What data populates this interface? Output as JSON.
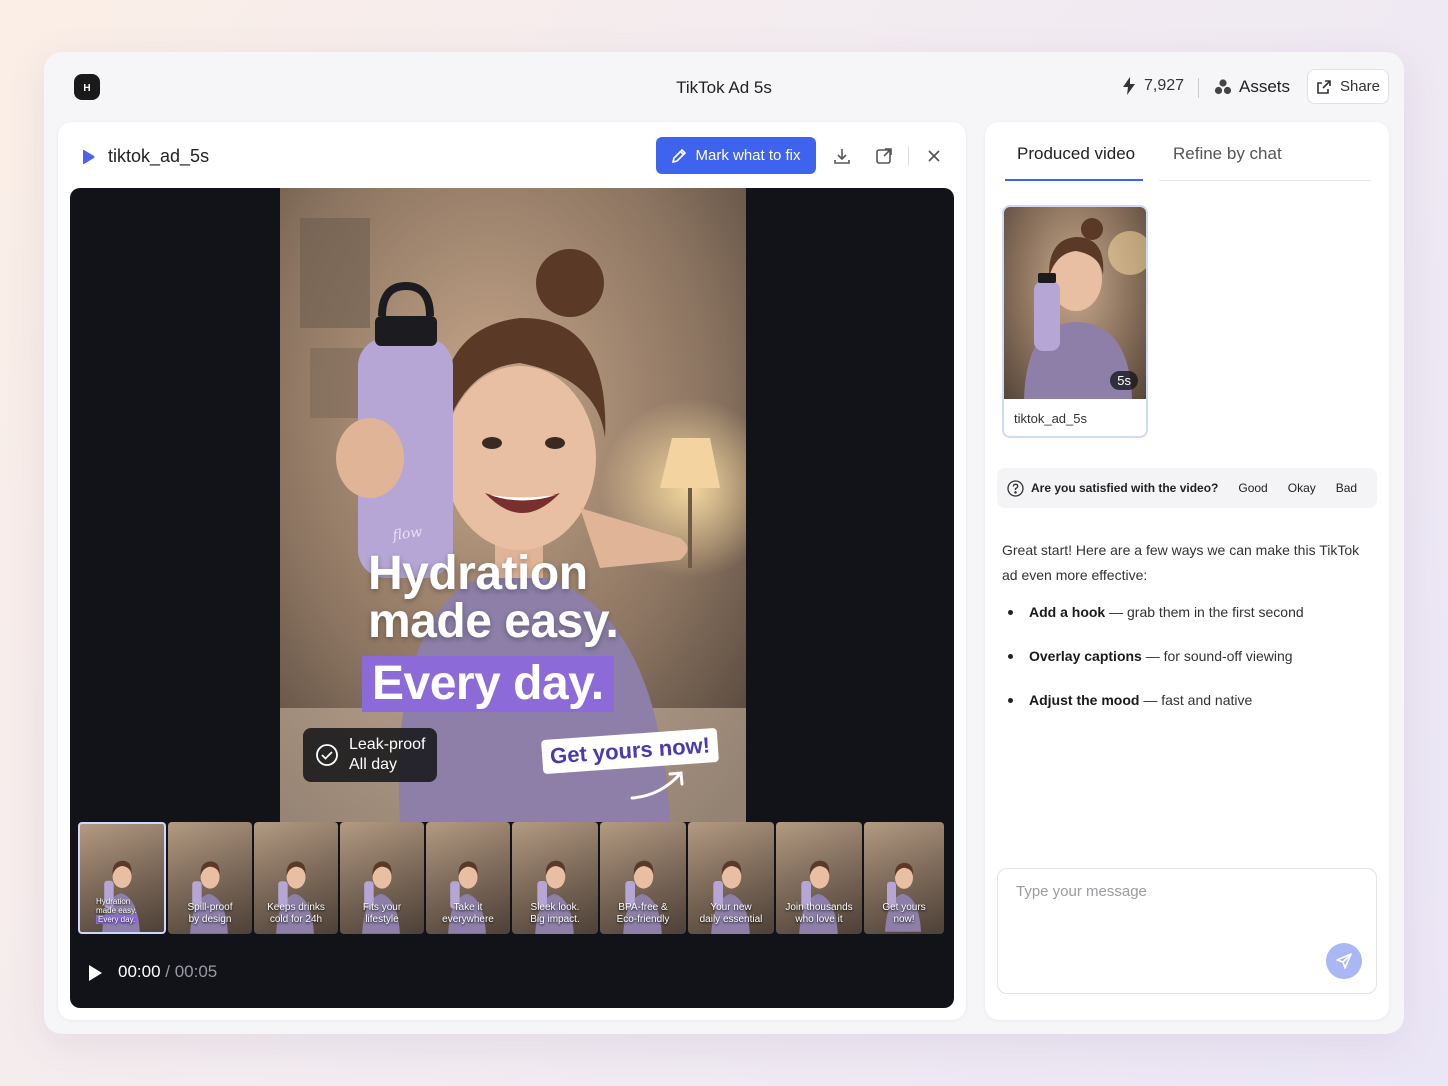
{
  "window": {
    "title": "TikTok Ad 5s"
  },
  "header": {
    "credits": "7,927",
    "assets_label": "Assets",
    "share_label": "Share"
  },
  "editor": {
    "file_name": "tiktok_ad_5s",
    "mark_label": "Mark what to fix",
    "accent": "#3e63ee"
  },
  "video": {
    "caption_line1": "Hydration",
    "caption_line2": "made easy.",
    "caption_highlight": "Every day.",
    "badge_line1": "Leak-proof",
    "badge_line2": "All day",
    "cta": "Get yours now!",
    "bottle_brand": "flow",
    "time_current": "00:00",
    "time_sep": " / ",
    "time_total": "00:05"
  },
  "thumbnails": [
    {
      "l1": "Hydration",
      "l2": "made easy.",
      "l3": "Every day."
    },
    {
      "l1": "Spill-proof",
      "l2": "by design"
    },
    {
      "l1": "Keeps drinks",
      "l2": "cold for 24h"
    },
    {
      "l1": "Fits your",
      "l2": "lifestyle"
    },
    {
      "l1": "Take it",
      "l2": "everywhere"
    },
    {
      "l1": "Sleek look.",
      "l2": "Big impact."
    },
    {
      "l1": "BPA-free &",
      "l2": "Eco-friendly"
    },
    {
      "l1": "Your new",
      "l2": "daily essential"
    },
    {
      "l1": "Join thousands",
      "l2": "who love it"
    },
    {
      "l1": "Get yours",
      "l2": "now!"
    }
  ],
  "right": {
    "tabs": [
      "Produced video",
      "Refine by chat"
    ],
    "produced": {
      "duration": "5s",
      "name": "tiktok_ad_5s"
    },
    "feedback": {
      "question": "Are you satisfied with the video?",
      "options": [
        "Good",
        "Okay",
        "Bad"
      ]
    },
    "chat": {
      "intro": "Great start! Here are a few ways we can make this TikTok ad even more effective:",
      "bullets": [
        {
          "bold": "Add a hook",
          "rest": " — grab them in the first second"
        },
        {
          "bold": "Overlay captions",
          "rest": " — for sound-off viewing"
        },
        {
          "bold": "Adjust the mood",
          "rest": " — fast and native"
        }
      ]
    },
    "input": {
      "placeholder": "Type your message",
      "value": ""
    }
  },
  "icons": {
    "logo": "app-logo-icon",
    "credits": "lightning-icon",
    "assets": "assets-icon",
    "share": "share-icon",
    "file": "video-file-icon",
    "mark": "pencil-icon",
    "download": "download-icon",
    "open": "open-external-icon",
    "close": "close-icon",
    "play": "play-icon",
    "help": "help-circle-icon",
    "send": "send-icon"
  }
}
